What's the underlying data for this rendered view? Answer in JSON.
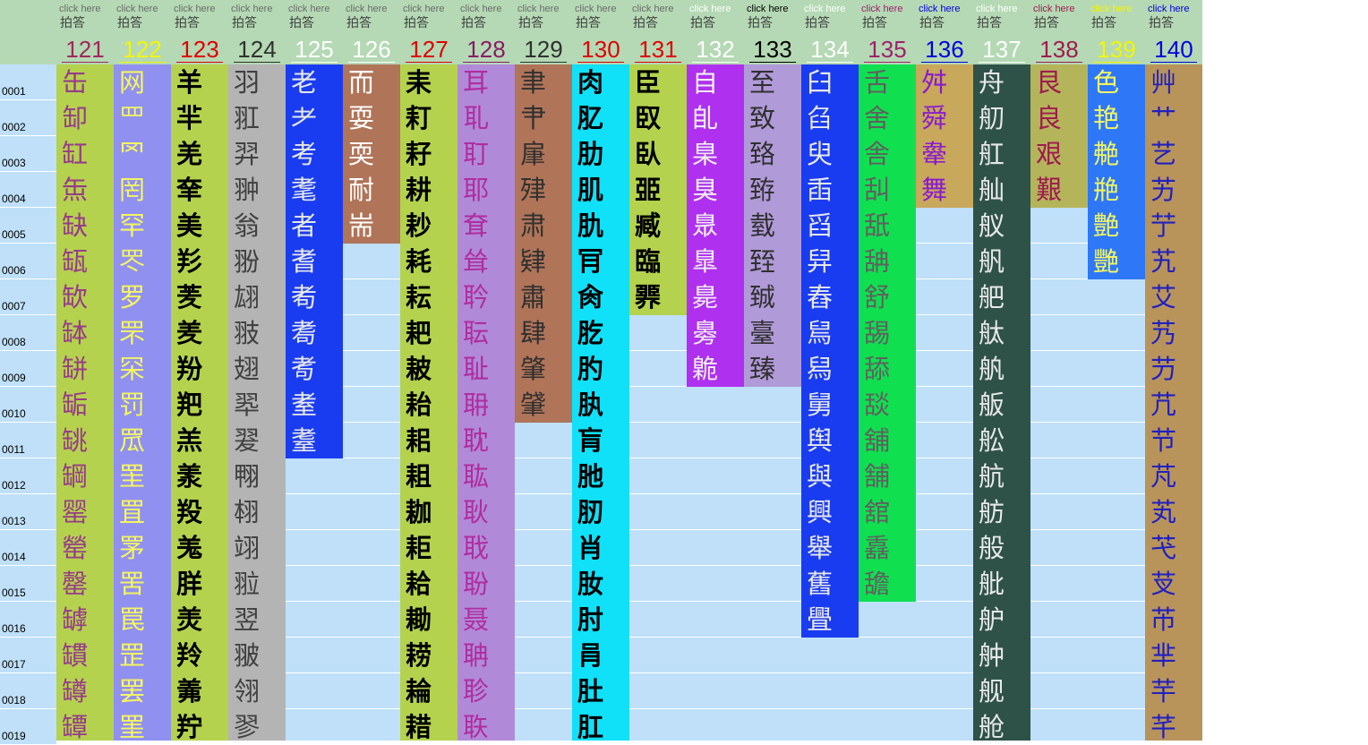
{
  "header": {
    "click_label": "click here",
    "answer_label": "拍答"
  },
  "row_labels": [
    "0001",
    "0002",
    "0003",
    "0004",
    "0005",
    "0006",
    "0007",
    "0008",
    "0009",
    "0010",
    "0011",
    "0012",
    "0013",
    "0014",
    "0015",
    "0016",
    "0017",
    "0018",
    "0019"
  ],
  "columns": [
    {
      "num": "121",
      "bg": "#b4d24e",
      "fg": "#983a8a",
      "click_color": "#6b6b6b",
      "num_color": "#a0285a",
      "bold": false,
      "chars": [
        "缶",
        "缷",
        "缸",
        "缹",
        "缺",
        "缻",
        "缼",
        "缽",
        "缾",
        "缿",
        "罀",
        "罁",
        "罂",
        "罃",
        "罄",
        "罅",
        "罆",
        "罇",
        "罈"
      ]
    },
    {
      "num": "122",
      "bg": "#9090f0",
      "fg": "#f5f560",
      "click_color": "#6b6b6b",
      "num_color": "#f5f500",
      "bold": false,
      "chars": [
        "网",
        "罒",
        "罓",
        "罔",
        "罕",
        "罖",
        "罗",
        "罘",
        "罙",
        "罚",
        "罛",
        "罜",
        "罝",
        "罞",
        "罟",
        "罠",
        "罡",
        "罢",
        "罣"
      ]
    },
    {
      "num": "123",
      "bg": "#b4d24e",
      "fg": "#000000",
      "click_color": "#6b6b6b",
      "num_color": "#e00000",
      "bold": true,
      "chars": [
        "羊",
        "羋",
        "羌",
        "羍",
        "美",
        "羏",
        "羐",
        "羑",
        "羒",
        "羓",
        "羔",
        "羕",
        "羖",
        "羗",
        "羘",
        "羙",
        "羚",
        "羛",
        "羜"
      ]
    },
    {
      "num": "124",
      "bg": "#b4b4b4",
      "fg": "#404040",
      "click_color": "#6b6b6b",
      "num_color": "#303030",
      "bold": false,
      "chars": [
        "羽",
        "羾",
        "羿",
        "翀",
        "翁",
        "翂",
        "翃",
        "翄",
        "翅",
        "翆",
        "翇",
        "翈",
        "翉",
        "翊",
        "翋",
        "翌",
        "翍",
        "翎",
        "翏"
      ]
    },
    {
      "num": "125",
      "bg": "#1a3cf0",
      "fg": "#e8e8e8",
      "click_color": "#6b6b6b",
      "num_color": "#ffffff",
      "bold": false,
      "chars": [
        "老",
        "耂",
        "考",
        "耄",
        "者",
        "耆",
        "耇",
        "耈",
        "耉",
        "耊",
        "耋",
        "",
        "",
        "",
        "",
        "",
        "",
        "",
        ""
      ]
    },
    {
      "num": "126",
      "bg": "#b07458",
      "fg": "#ffffff",
      "click_color": "#6b6b6b",
      "num_color": "#ffffff",
      "bold": false,
      "chars": [
        "而",
        "耍",
        "耎",
        "耐",
        "耑",
        "",
        "",
        "",
        "",
        "",
        "",
        "",
        "",
        "",
        "",
        "",
        "",
        "",
        ""
      ]
    },
    {
      "num": "127",
      "bg": "#b4d24e",
      "fg": "#000000",
      "click_color": "#6b6b6b",
      "num_color": "#e00000",
      "bold": true,
      "chars": [
        "耒",
        "耓",
        "耔",
        "耕",
        "耖",
        "耗",
        "耘",
        "耙",
        "耚",
        "耛",
        "耜",
        "耝",
        "耞",
        "耟",
        "耠",
        "耡",
        "耢",
        "耣",
        "耤"
      ]
    },
    {
      "num": "128",
      "bg": "#b08ad8",
      "fg": "#b02ca0",
      "click_color": "#6b6b6b",
      "num_color": "#8a1a6a",
      "bold": false,
      "chars": [
        "耳",
        "耴",
        "耵",
        "耶",
        "耷",
        "耸",
        "耹",
        "耺",
        "耻",
        "耼",
        "耽",
        "耾",
        "耿",
        "聀",
        "聁",
        "聂",
        "聃",
        "聄",
        "聅"
      ]
    },
    {
      "num": "129",
      "bg": "#b07458",
      "fg": "#303030",
      "click_color": "#6b6b6b",
      "num_color": "#303030",
      "bold": false,
      "chars": [
        "聿",
        "肀",
        "肁",
        "肂",
        "肃",
        "肄",
        "肅",
        "肆",
        "肇",
        "肈",
        "",
        "",
        "",
        "",
        "",
        "",
        "",
        "",
        ""
      ]
    },
    {
      "num": "130",
      "bg": "#10e0f8",
      "fg": "#000000",
      "click_color": "#6b6b6b",
      "num_color": "#e00000",
      "bold": true,
      "chars": [
        "肉",
        "肊",
        "肋",
        "肌",
        "肍",
        "肎",
        "肏",
        "肐",
        "肑",
        "肒",
        "肓",
        "肔",
        "肕",
        "肖",
        "肗",
        "肘",
        "肙",
        "肚",
        "肛"
      ]
    },
    {
      "num": "131",
      "bg": "#b4d24e",
      "fg": "#000000",
      "click_color": "#6b6b6b",
      "num_color": "#e00000",
      "bold": true,
      "chars": [
        "臣",
        "臤",
        "臥",
        "臦",
        "臧",
        "臨",
        "臩",
        "",
        "",
        "",
        "",
        "",
        "",
        "",
        "",
        "",
        "",
        "",
        ""
      ]
    },
    {
      "num": "132",
      "bg": "#b030f0",
      "fg": "#f0f0f0",
      "click_color": "#ffffff",
      "num_color": "#ffffff",
      "bold": false,
      "chars": [
        "自",
        "臫",
        "臬",
        "臭",
        "臮",
        "臯",
        "臰",
        "臱",
        "臲",
        "",
        "",
        "",
        "",
        "",
        "",
        "",
        "",
        "",
        ""
      ]
    },
    {
      "num": "133",
      "bg": "#b09ad8",
      "fg": "#303030",
      "click_color": "#000000",
      "num_color": "#000000",
      "bold": false,
      "chars": [
        "至",
        "致",
        "臵",
        "臶",
        "臷",
        "臸",
        "臹",
        "臺",
        "臻",
        "",
        "",
        "",
        "",
        "",
        "",
        "",
        "",
        "",
        ""
      ]
    },
    {
      "num": "134",
      "bg": "#1a3cf0",
      "fg": "#e8e8e8",
      "click_color": "#ffffff",
      "num_color": "#ffffff",
      "bold": false,
      "chars": [
        "臼",
        "臽",
        "臾",
        "臿",
        "舀",
        "舁",
        "舂",
        "舃",
        "舄",
        "舅",
        "舆",
        "與",
        "興",
        "舉",
        "舊",
        "舋",
        "",
        "",
        ""
      ]
    },
    {
      "num": "135",
      "bg": "#10e050",
      "fg": "#606060",
      "click_color": "#a02070",
      "num_color": "#a02070",
      "bold": false,
      "chars": [
        "舌",
        "舍",
        "舎",
        "舏",
        "舐",
        "舑",
        "舒",
        "舓",
        "舔",
        "舕",
        "舖",
        "舗",
        "舘",
        "舙",
        "舚",
        "",
        "",
        "",
        ""
      ]
    },
    {
      "num": "136",
      "bg": "#c8a85a",
      "fg": "#8a1ad0",
      "click_color": "#0000e0",
      "num_color": "#0000e0",
      "bold": false,
      "chars": [
        "舛",
        "舜",
        "舝",
        "舞",
        "",
        "",
        "",
        "",
        "",
        "",
        "",
        "",
        "",
        "",
        "",
        "",
        "",
        "",
        ""
      ]
    },
    {
      "num": "137",
      "bg": "#2e5248",
      "fg": "#e8e8e8",
      "click_color": "#ffffff",
      "num_color": "#ffffff",
      "bold": false,
      "chars": [
        "舟",
        "舠",
        "舡",
        "舢",
        "舣",
        "舤",
        "舥",
        "舦",
        "舧",
        "舨",
        "舩",
        "航",
        "舫",
        "般",
        "舭",
        "舮",
        "舯",
        "舰",
        "舱"
      ]
    },
    {
      "num": "138",
      "bg": "#b4b45a",
      "fg": "#a01a50",
      "click_color": "#a01a50",
      "num_color": "#a01a50",
      "bold": false,
      "chars": [
        "艮",
        "良",
        "艰",
        "艱",
        "",
        "",
        "",
        "",
        "",
        "",
        "",
        "",
        "",
        "",
        "",
        "",
        "",
        "",
        ""
      ]
    },
    {
      "num": "139",
      "bg": "#2e78f8",
      "fg": "#f5f560",
      "click_color": "#f5f500",
      "num_color": "#f5f500",
      "bold": false,
      "chars": [
        "色",
        "艳",
        "艴",
        "艵",
        "艶",
        "艷",
        "",
        "",
        "",
        "",
        "",
        "",
        "",
        "",
        "",
        "",
        "",
        "",
        ""
      ]
    },
    {
      "num": "140",
      "bg": "#b8945a",
      "fg": "#2020c0",
      "click_color": "#0000e0",
      "num_color": "#0000e0",
      "bold": false,
      "chars": [
        "艸",
        "艹",
        "艺",
        "艻",
        "艼",
        "艽",
        "艾",
        "艿",
        "芀",
        "芁",
        "节",
        "芃",
        "芄",
        "芅",
        "芆",
        "芇",
        "芈",
        "芉",
        "芊"
      ]
    }
  ]
}
